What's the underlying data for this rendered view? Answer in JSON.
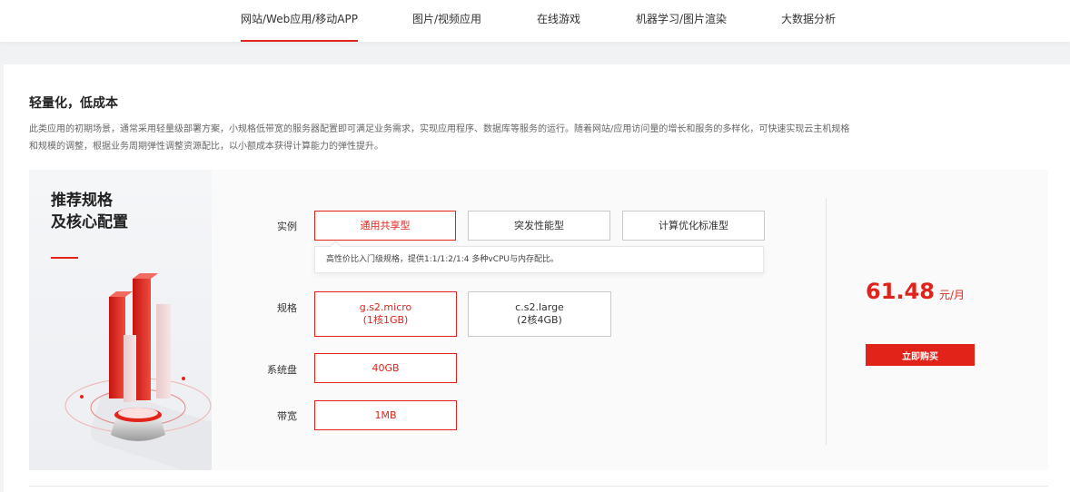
{
  "nav": {
    "tabs": [
      {
        "label": "网站/Web应用/移动APP",
        "active": true
      },
      {
        "label": "图片/视频应用"
      },
      {
        "label": "在线游戏"
      },
      {
        "label": "机器学习/图片渲染"
      },
      {
        "label": "大数据分析"
      }
    ]
  },
  "section": {
    "title": "轻量化，低成本",
    "description": "此类应用的初期场景，通常采用轻量级部署方案，小规格低带宽的服务器配置即可满足业务需求，实现应用程序、数据库等服务的运行。随着网站/应用访问量的增长和服务的多样化，可快速实现云主机规格和规模的调整，根据业务周期弹性调整资源配比，以小额成本获得计算能力的弹性提升。"
  },
  "card": {
    "title_line1": "推荐规格",
    "title_line2": "及核心配置",
    "instance": {
      "label": "实例",
      "options": [
        "通用共享型",
        "突发性能型",
        "计算优化标准型"
      ],
      "selected": 0,
      "tip": "高性价比入门级规格，提供1:1/1:2/1:4 多种vCPU与内存配比。"
    },
    "spec": {
      "label": "规格",
      "options": [
        {
          "name": "g.s2.micro",
          "detail": "(1核1GB)"
        },
        {
          "name": "c.s2.large",
          "detail": "(2核4GB)"
        }
      ],
      "selected": 0
    },
    "disk": {
      "label": "系统盘",
      "value": "40GB"
    },
    "bandwidth": {
      "label": "带宽",
      "value": "1MB"
    },
    "price": {
      "amount": "61.48",
      "unit": "元/月"
    },
    "buy_label": "立即购买"
  },
  "colors": {
    "accent": "#e2231a"
  }
}
